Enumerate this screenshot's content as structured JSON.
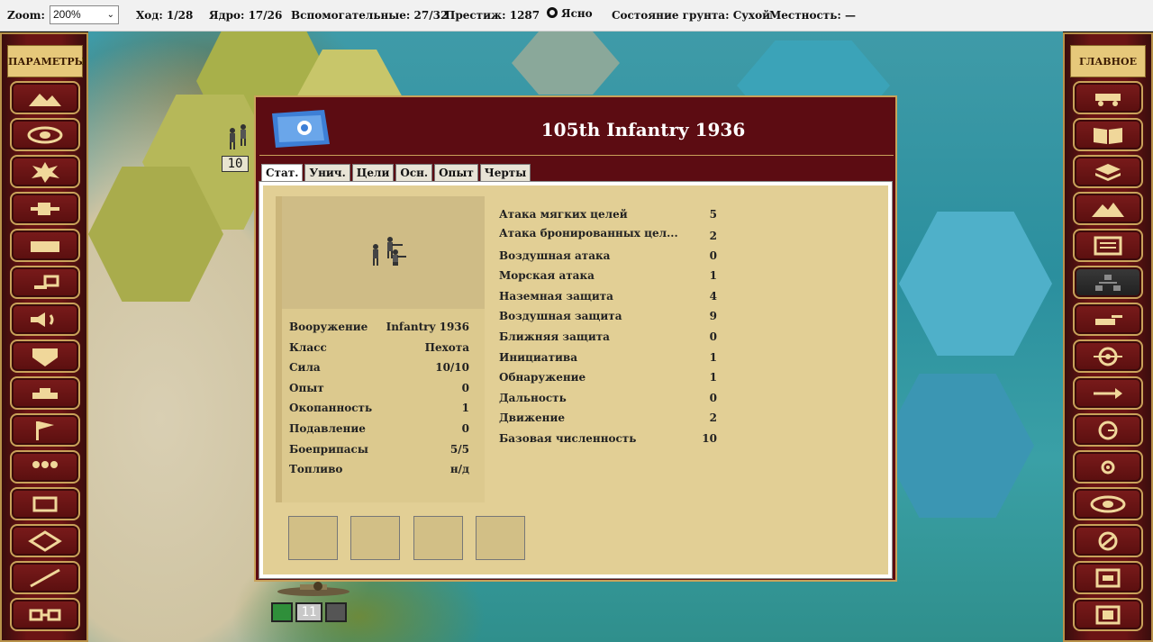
{
  "topbar": {
    "zoom_label": "Zoom:",
    "zoom_value": "200%",
    "turn": "Ход: 1/28",
    "core": "Ядро: 17/26",
    "aux": "Вспомогательные: 27/32",
    "prestige": "Престиж: 1287",
    "weather": "Ясно",
    "ground": "Состояние грунта: Сухой",
    "terrain": "Местность: —"
  },
  "left_panel": {
    "title": "ПАРАМЕТРЫ",
    "buttons": [
      "terrain-icon",
      "eye-icon",
      "explosion-icon",
      "aircraft-icon",
      "supply-icon",
      "flag-small-icon",
      "sound-icon",
      "shield-icon",
      "tank-icon",
      "flag-icon",
      "units-icon",
      "frame-icon",
      "hex-icon",
      "line-icon",
      "link-icon"
    ]
  },
  "right_panel": {
    "title": "ГЛАВНОЕ",
    "buttons": [
      "unit-icon",
      "book-icon",
      "layers-icon",
      "mountain-icon",
      "list-icon",
      "org-icon",
      "artillery-icon",
      "target-icon",
      "arrow-icon",
      "clock-icon",
      "center-icon",
      "eye-icon",
      "dial-icon",
      "save-icon",
      "load-icon"
    ],
    "active_index": 5
  },
  "map": {
    "unit_strength": "10",
    "bottom_unit_strength": "11"
  },
  "dialog": {
    "title": "105th Infantry 1936",
    "tabs": [
      "Стат.",
      "Унич.",
      "Цели",
      "Осн.",
      "Опыт",
      "Черты"
    ],
    "active_tab": 0,
    "left_stats": [
      {
        "label": "Вооружение",
        "value": "Infantry 1936"
      },
      {
        "label": "Класс",
        "value": "Пехота"
      },
      {
        "label": "Сила",
        "value": "10/10"
      },
      {
        "label": "Опыт",
        "value": "0"
      },
      {
        "label": "Окопанность",
        "value": "1"
      },
      {
        "label": "Подавление",
        "value": "0"
      },
      {
        "label": "Боеприпасы",
        "value": "5/5"
      },
      {
        "label": "Топливо",
        "value": "н/д"
      }
    ],
    "right_stats": [
      {
        "label": "Атака мягких целей",
        "value": "5"
      },
      {
        "label": "Атака бронированных цел...",
        "value": "2"
      },
      {
        "label": "Воздушная атака",
        "value": "0"
      },
      {
        "label": "Морская атака",
        "value": "1"
      },
      {
        "label": "Наземная защита",
        "value": "4"
      },
      {
        "label": "Воздушная защита",
        "value": "9"
      },
      {
        "label": "Ближняя защита",
        "value": "0"
      },
      {
        "label": "Инициатива",
        "value": "1"
      },
      {
        "label": "Обнаружение",
        "value": "1"
      },
      {
        "label": "Дальность",
        "value": "0"
      },
      {
        "label": "Движение",
        "value": "2"
      },
      {
        "label": "Базовая численность",
        "value": "10"
      }
    ]
  }
}
